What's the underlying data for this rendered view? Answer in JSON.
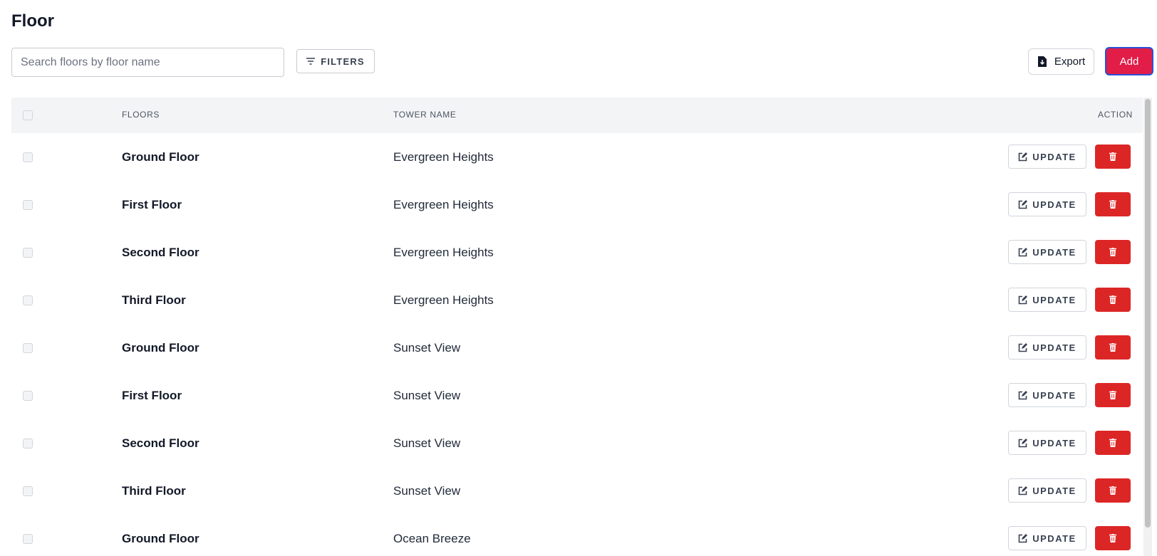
{
  "page": {
    "title": "Floor"
  },
  "toolbar": {
    "search_placeholder": "Search floors by floor name",
    "search_value": "",
    "filters_label": "FILTERS",
    "export_label": "Export",
    "add_label": "Add"
  },
  "table": {
    "columns": {
      "floors": "FLOORS",
      "tower_name": "TOWER NAME",
      "action": "ACTION"
    },
    "update_label": "UPDATE",
    "rows": [
      {
        "floor": "Ground Floor",
        "tower": "Evergreen Heights"
      },
      {
        "floor": "First Floor",
        "tower": "Evergreen Heights"
      },
      {
        "floor": "Second Floor",
        "tower": "Evergreen Heights"
      },
      {
        "floor": "Third Floor",
        "tower": "Evergreen Heights"
      },
      {
        "floor": "Ground Floor",
        "tower": "Sunset View"
      },
      {
        "floor": "First Floor",
        "tower": "Sunset View"
      },
      {
        "floor": "Second Floor",
        "tower": "Sunset View"
      },
      {
        "floor": "Third Floor",
        "tower": "Sunset View"
      },
      {
        "floor": "Ground Floor",
        "tower": "Ocean Breeze"
      }
    ]
  },
  "colors": {
    "accent": "#e11d48",
    "danger": "#dc2626",
    "header_bg": "#f3f4f6"
  },
  "icons": {
    "filter": "filter-icon",
    "export": "file-export-icon",
    "update": "edit-icon",
    "delete": "trash-icon"
  }
}
